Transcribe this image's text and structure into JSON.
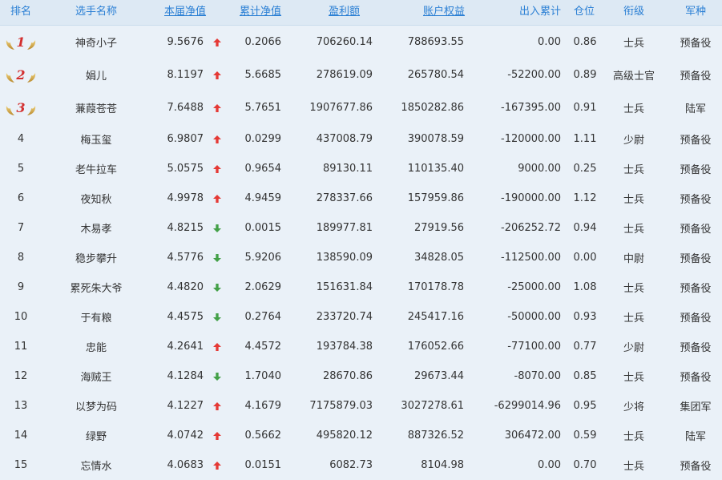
{
  "colors": {
    "accent": "#2a7fd4",
    "up": "#e53935",
    "down": "#43a047",
    "header_bg": "#dde9f4",
    "row_bg": "#eaf1f8"
  },
  "headers": {
    "rank": "排名",
    "name": "选手名称",
    "net": "本届净值",
    "cum": "累计净值",
    "profit": "盈利额",
    "equity": "账户权益",
    "io": "出入累计",
    "pos": "仓位",
    "grade": "衔级",
    "army": "军种"
  },
  "rows": [
    {
      "rank": "1",
      "name": "神奇小子",
      "net": "9.5676",
      "dir": "up",
      "cum": "0.2066",
      "profit": "706260.14",
      "equity": "788693.55",
      "io": "0.00",
      "pos": "0.86",
      "grade": "士兵",
      "army": "预备役"
    },
    {
      "rank": "2",
      "name": "娟儿",
      "net": "8.1197",
      "dir": "up",
      "cum": "5.6685",
      "profit": "278619.09",
      "equity": "265780.54",
      "io": "-52200.00",
      "pos": "0.89",
      "grade": "高级士官",
      "army": "预备役"
    },
    {
      "rank": "3",
      "name": "蒹葭苍苍",
      "net": "7.6488",
      "dir": "up",
      "cum": "5.7651",
      "profit": "1907677.86",
      "equity": "1850282.86",
      "io": "-167395.00",
      "pos": "0.91",
      "grade": "士兵",
      "army": "陆军"
    },
    {
      "rank": "4",
      "name": "梅玉玺",
      "net": "6.9807",
      "dir": "up",
      "cum": "0.0299",
      "profit": "437008.79",
      "equity": "390078.59",
      "io": "-120000.00",
      "pos": "1.11",
      "grade": "少尉",
      "army": "预备役"
    },
    {
      "rank": "5",
      "name": "老牛拉车",
      "net": "5.0575",
      "dir": "up",
      "cum": "0.9654",
      "profit": "89130.11",
      "equity": "110135.40",
      "io": "9000.00",
      "pos": "0.25",
      "grade": "士兵",
      "army": "预备役"
    },
    {
      "rank": "6",
      "name": "夜知秋",
      "net": "4.9978",
      "dir": "up",
      "cum": "4.9459",
      "profit": "278337.66",
      "equity": "157959.86",
      "io": "-190000.00",
      "pos": "1.12",
      "grade": "士兵",
      "army": "预备役"
    },
    {
      "rank": "7",
      "name": "木易孝",
      "net": "4.8215",
      "dir": "down",
      "cum": "0.0015",
      "profit": "189977.81",
      "equity": "27919.56",
      "io": "-206252.72",
      "pos": "0.94",
      "grade": "士兵",
      "army": "预备役"
    },
    {
      "rank": "8",
      "name": "稳步攀升",
      "net": "4.5776",
      "dir": "down",
      "cum": "5.9206",
      "profit": "138590.09",
      "equity": "34828.05",
      "io": "-112500.00",
      "pos": "0.00",
      "grade": "中尉",
      "army": "预备役"
    },
    {
      "rank": "9",
      "name": "累死朱大爷",
      "net": "4.4820",
      "dir": "down",
      "cum": "2.0629",
      "profit": "151631.84",
      "equity": "170178.78",
      "io": "-25000.00",
      "pos": "1.08",
      "grade": "士兵",
      "army": "预备役"
    },
    {
      "rank": "10",
      "name": "于有粮",
      "net": "4.4575",
      "dir": "down",
      "cum": "0.2764",
      "profit": "233720.74",
      "equity": "245417.16",
      "io": "-50000.00",
      "pos": "0.93",
      "grade": "士兵",
      "army": "预备役"
    },
    {
      "rank": "11",
      "name": "忠能",
      "net": "4.2641",
      "dir": "up",
      "cum": "4.4572",
      "profit": "193784.38",
      "equity": "176052.66",
      "io": "-77100.00",
      "pos": "0.77",
      "grade": "少尉",
      "army": "预备役"
    },
    {
      "rank": "12",
      "name": "海贼王",
      "net": "4.1284",
      "dir": "down",
      "cum": "1.7040",
      "profit": "28670.86",
      "equity": "29673.44",
      "io": "-8070.00",
      "pos": "0.85",
      "grade": "士兵",
      "army": "预备役"
    },
    {
      "rank": "13",
      "name": "以梦为码",
      "net": "4.1227",
      "dir": "up",
      "cum": "4.1679",
      "profit": "7175879.03",
      "equity": "3027278.61",
      "io": "-6299014.96",
      "pos": "0.95",
      "grade": "少将",
      "army": "集团军"
    },
    {
      "rank": "14",
      "name": "绿野",
      "net": "4.0742",
      "dir": "up",
      "cum": "0.5662",
      "profit": "495820.12",
      "equity": "887326.52",
      "io": "306472.00",
      "pos": "0.59",
      "grade": "士兵",
      "army": "陆军"
    },
    {
      "rank": "15",
      "name": "忘情水",
      "net": "4.0683",
      "dir": "up",
      "cum": "0.0151",
      "profit": "6082.73",
      "equity": "8104.98",
      "io": "0.00",
      "pos": "0.70",
      "grade": "士兵",
      "army": "预备役"
    }
  ]
}
